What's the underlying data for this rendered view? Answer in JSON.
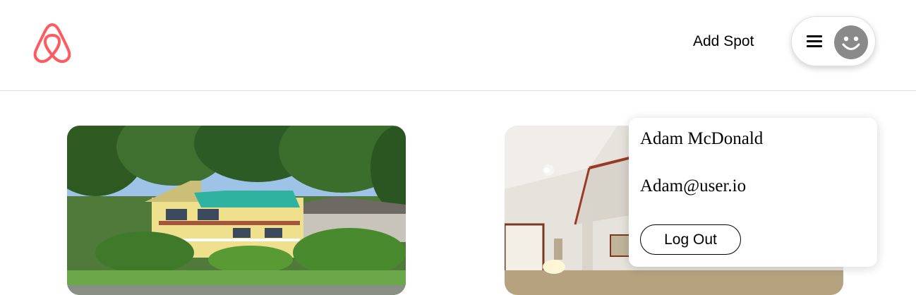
{
  "header": {
    "logo_icon": "airbnb-logo-icon",
    "logo_color": "#ff5a5f",
    "add_spot_label": "Add Spot",
    "menu_icon": "hamburger-icon",
    "avatar_icon": "smiley-avatar-icon"
  },
  "spots": [
    {
      "image": "lake-house-photo"
    },
    {
      "image": "interior-living-room-photo"
    }
  ],
  "profile_menu": {
    "name": "Adam McDonald",
    "email": "Adam@user.io",
    "logout_label": "Log Out"
  }
}
